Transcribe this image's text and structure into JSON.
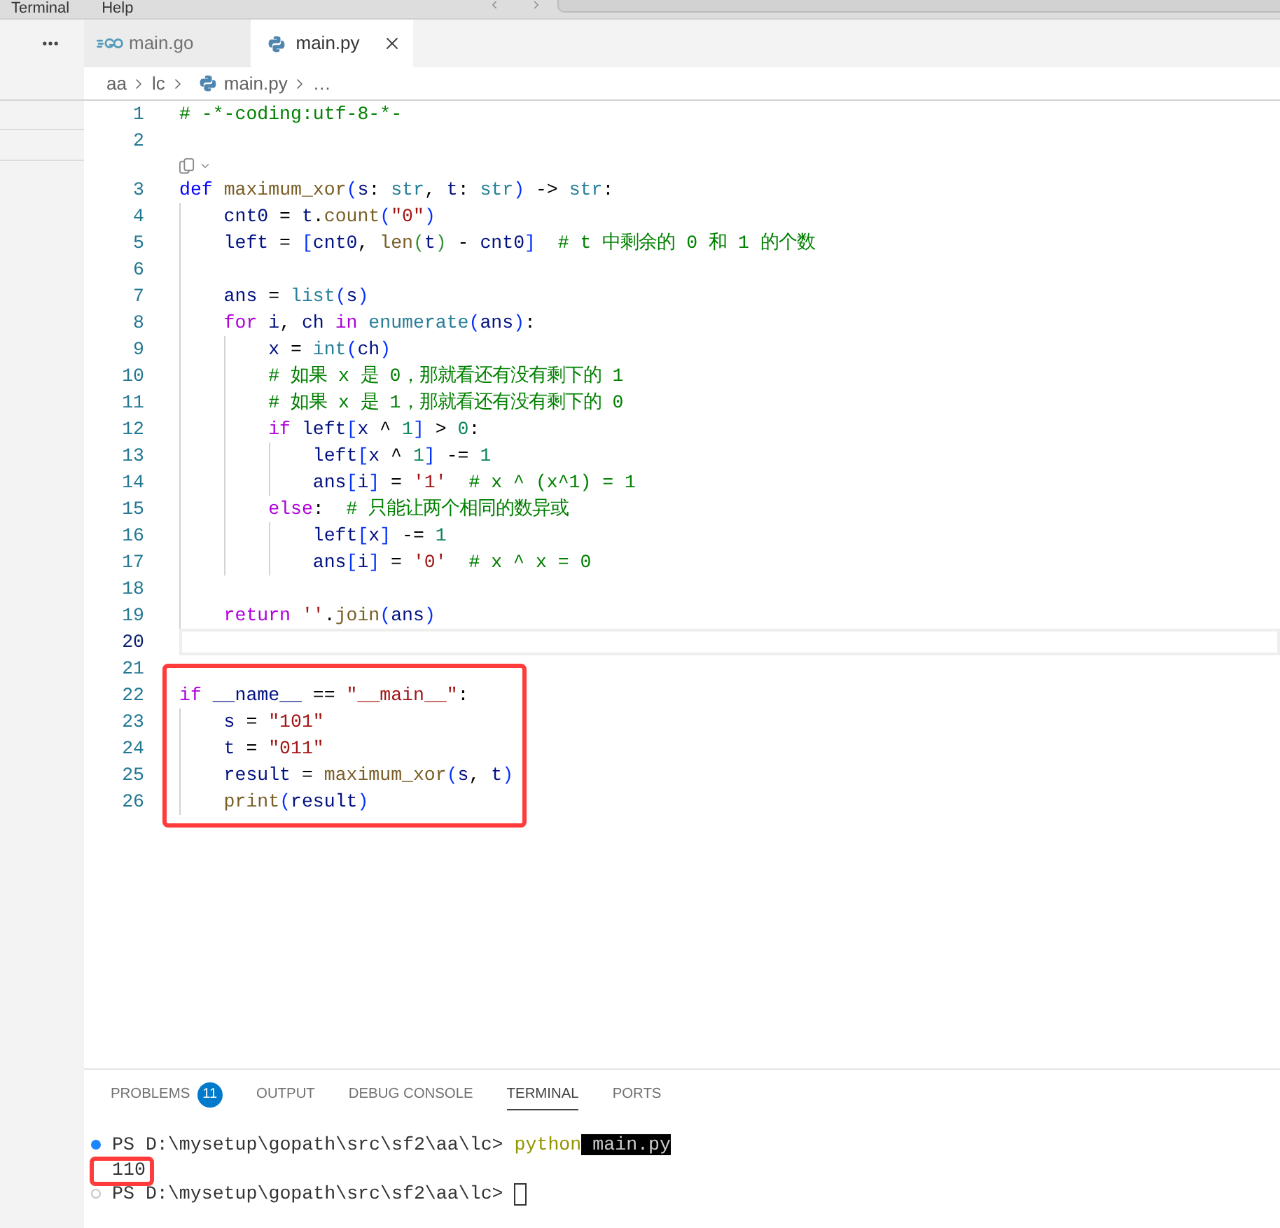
{
  "title_bar": {
    "menus": [
      "Terminal",
      "Help"
    ]
  },
  "tabs": [
    {
      "label": "main.go",
      "kind": "go",
      "selected": false
    },
    {
      "label": "main.py",
      "kind": "python",
      "selected": true
    }
  ],
  "breadcrumbs": [
    {
      "label": "aa",
      "kind": "folder"
    },
    {
      "label": "lc",
      "kind": "folder"
    },
    {
      "label": "main.py",
      "kind": "python"
    },
    {
      "label": "…",
      "kind": "symbol"
    }
  ],
  "editor": {
    "lines": [
      {
        "kind": "code",
        "number": "1",
        "current": false,
        "boxed": false,
        "tokens": [
          {
            "text": "# -*-coding:utf-8-*-",
            "kind": "comment"
          }
        ]
      },
      {
        "kind": "code",
        "number": "2",
        "current": false,
        "boxed": false
      },
      {
        "kind": "lens",
        "current": false,
        "boxed": false
      },
      {
        "kind": "code",
        "number": "3",
        "current": false,
        "boxed": false,
        "tokens": [
          {
            "text": "def ",
            "kind": "keyword"
          },
          {
            "text": "maximum_xor",
            "kind": "function"
          },
          {
            "text": "(",
            "kind": "bracket1"
          },
          {
            "text": "s",
            "kind": "variable"
          },
          {
            "text": ": ",
            "kind": "operator"
          },
          {
            "text": "str",
            "kind": "type"
          },
          {
            "text": ", ",
            "kind": "operator"
          },
          {
            "text": "t",
            "kind": "variable"
          },
          {
            "text": ": ",
            "kind": "operator"
          },
          {
            "text": "str",
            "kind": "type"
          },
          {
            "text": ")",
            "kind": "bracket1"
          },
          {
            "text": " -> ",
            "kind": "operator"
          },
          {
            "text": "str",
            "kind": "type"
          },
          {
            "text": ":",
            "kind": "operator"
          }
        ]
      },
      {
        "kind": "code",
        "number": "4",
        "current": false,
        "boxed": false,
        "tokens": [
          {
            "text": "    cnt0",
            "kind": "variable"
          },
          {
            "text": " = ",
            "kind": "operator"
          },
          {
            "text": "t",
            "kind": "variable"
          },
          {
            "text": ".",
            "kind": "operator"
          },
          {
            "text": "count",
            "kind": "function"
          },
          {
            "text": "(",
            "kind": "bracket1"
          },
          {
            "text": "\"0\"",
            "kind": "string"
          },
          {
            "text": ")",
            "kind": "bracket1"
          }
        ]
      },
      {
        "kind": "code",
        "number": "5",
        "current": false,
        "boxed": false,
        "tokens": [
          {
            "text": "    left",
            "kind": "variable"
          },
          {
            "text": " = ",
            "kind": "operator"
          },
          {
            "text": "[",
            "kind": "bracket1"
          },
          {
            "text": "cnt0",
            "kind": "variable"
          },
          {
            "text": ", ",
            "kind": "operator"
          },
          {
            "text": "len",
            "kind": "function"
          },
          {
            "text": "(",
            "kind": "bracket2"
          },
          {
            "text": "t",
            "kind": "variable"
          },
          {
            "text": ")",
            "kind": "bracket2"
          },
          {
            "text": " - ",
            "kind": "operator"
          },
          {
            "text": "cnt0",
            "kind": "variable"
          },
          {
            "text": "]",
            "kind": "bracket1"
          },
          {
            "text": "  # t 中剩余的 0 和 1 的个数",
            "kind": "comment"
          }
        ]
      },
      {
        "kind": "code",
        "number": "6",
        "current": false,
        "boxed": false
      },
      {
        "kind": "code",
        "number": "7",
        "current": false,
        "boxed": false,
        "tokens": [
          {
            "text": "    ans",
            "kind": "variable"
          },
          {
            "text": " = ",
            "kind": "operator"
          },
          {
            "text": "list",
            "kind": "type"
          },
          {
            "text": "(",
            "kind": "bracket1"
          },
          {
            "text": "s",
            "kind": "variable"
          },
          {
            "text": ")",
            "kind": "bracket1"
          }
        ]
      },
      {
        "kind": "code",
        "number": "8",
        "current": false,
        "boxed": false,
        "tokens": [
          {
            "text": "    for",
            "kind": "control"
          },
          {
            "text": " i",
            "kind": "variable"
          },
          {
            "text": ", ",
            "kind": "operator"
          },
          {
            "text": "ch",
            "kind": "variable"
          },
          {
            "text": " in",
            "kind": "control"
          },
          {
            "text": " enumerate",
            "kind": "type"
          },
          {
            "text": "(",
            "kind": "bracket1"
          },
          {
            "text": "ans",
            "kind": "variable"
          },
          {
            "text": ")",
            "kind": "bracket1"
          },
          {
            "text": ":",
            "kind": "operator"
          }
        ]
      },
      {
        "kind": "code",
        "number": "9",
        "current": false,
        "boxed": false,
        "tokens": [
          {
            "text": "        x",
            "kind": "variable"
          },
          {
            "text": " = ",
            "kind": "operator"
          },
          {
            "text": "int",
            "kind": "type"
          },
          {
            "text": "(",
            "kind": "bracket1"
          },
          {
            "text": "ch",
            "kind": "variable"
          },
          {
            "text": ")",
            "kind": "bracket1"
          }
        ]
      },
      {
        "kind": "code",
        "number": "10",
        "current": false,
        "boxed": false,
        "tokens": [
          {
            "text": "        # 如果 x 是 0，那就看还有没有剩下的 1",
            "kind": "comment"
          }
        ]
      },
      {
        "kind": "code",
        "number": "11",
        "current": false,
        "boxed": false,
        "tokens": [
          {
            "text": "        # 如果 x 是 1，那就看还有没有剩下的 0",
            "kind": "comment"
          }
        ]
      },
      {
        "kind": "code",
        "number": "12",
        "current": false,
        "boxed": false,
        "tokens": [
          {
            "text": "        if",
            "kind": "control"
          },
          {
            "text": " left",
            "kind": "variable"
          },
          {
            "text": "[",
            "kind": "bracket1"
          },
          {
            "text": "x",
            "kind": "variable"
          },
          {
            "text": " ^ ",
            "kind": "operator"
          },
          {
            "text": "1",
            "kind": "number"
          },
          {
            "text": "]",
            "kind": "bracket1"
          },
          {
            "text": " > ",
            "kind": "operator"
          },
          {
            "text": "0",
            "kind": "number"
          },
          {
            "text": ":",
            "kind": "operator"
          }
        ]
      },
      {
        "kind": "code",
        "number": "13",
        "current": false,
        "boxed": false,
        "tokens": [
          {
            "text": "            left",
            "kind": "variable"
          },
          {
            "text": "[",
            "kind": "bracket1"
          },
          {
            "text": "x",
            "kind": "variable"
          },
          {
            "text": " ^ ",
            "kind": "operator"
          },
          {
            "text": "1",
            "kind": "number"
          },
          {
            "text": "]",
            "kind": "bracket1"
          },
          {
            "text": " -= ",
            "kind": "operator"
          },
          {
            "text": "1",
            "kind": "number"
          }
        ]
      },
      {
        "kind": "code",
        "number": "14",
        "current": false,
        "boxed": false,
        "tokens": [
          {
            "text": "            ans",
            "kind": "variable"
          },
          {
            "text": "[",
            "kind": "bracket1"
          },
          {
            "text": "i",
            "kind": "variable"
          },
          {
            "text": "]",
            "kind": "bracket1"
          },
          {
            "text": " = ",
            "kind": "operator"
          },
          {
            "text": "'1'",
            "kind": "string"
          },
          {
            "text": "  # x ^ (x^1) = 1",
            "kind": "comment"
          }
        ]
      },
      {
        "kind": "code",
        "number": "15",
        "current": false,
        "boxed": false,
        "tokens": [
          {
            "text": "        else",
            "kind": "control"
          },
          {
            "text": ":",
            "kind": "operator"
          },
          {
            "text": "  # 只能让两个相同的数异或",
            "kind": "comment"
          }
        ]
      },
      {
        "kind": "code",
        "number": "16",
        "current": false,
        "boxed": false,
        "tokens": [
          {
            "text": "            left",
            "kind": "variable"
          },
          {
            "text": "[",
            "kind": "bracket1"
          },
          {
            "text": "x",
            "kind": "variable"
          },
          {
            "text": "]",
            "kind": "bracket1"
          },
          {
            "text": " -= ",
            "kind": "operator"
          },
          {
            "text": "1",
            "kind": "number"
          }
        ]
      },
      {
        "kind": "code",
        "number": "17",
        "current": false,
        "boxed": false,
        "tokens": [
          {
            "text": "            ans",
            "kind": "variable"
          },
          {
            "text": "[",
            "kind": "bracket1"
          },
          {
            "text": "i",
            "kind": "variable"
          },
          {
            "text": "]",
            "kind": "bracket1"
          },
          {
            "text": " = ",
            "kind": "operator"
          },
          {
            "text": "'0'",
            "kind": "string"
          },
          {
            "text": "  # x ^ x = 0",
            "kind": "comment"
          }
        ]
      },
      {
        "kind": "code",
        "number": "18",
        "current": false,
        "boxed": false
      },
      {
        "kind": "code",
        "number": "19",
        "current": false,
        "boxed": false,
        "tokens": [
          {
            "text": "    return",
            "kind": "control"
          },
          {
            "text": " ''",
            "kind": "string"
          },
          {
            "text": ".",
            "kind": "operator"
          },
          {
            "text": "join",
            "kind": "function"
          },
          {
            "text": "(",
            "kind": "bracket1"
          },
          {
            "text": "ans",
            "kind": "variable"
          },
          {
            "text": ")",
            "kind": "bracket1"
          }
        ]
      },
      {
        "kind": "code",
        "number": "20",
        "current": true,
        "boxed": false
      },
      {
        "kind": "code",
        "number": "21",
        "current": false,
        "boxed": false
      },
      {
        "kind": "code",
        "number": "22",
        "current": false,
        "boxed": true,
        "tokens": [
          {
            "text": "if",
            "kind": "control"
          },
          {
            "text": " __name__",
            "kind": "variable"
          },
          {
            "text": " == ",
            "kind": "operator"
          },
          {
            "text": "\"__main__\"",
            "kind": "string"
          },
          {
            "text": ":",
            "kind": "operator"
          }
        ]
      },
      {
        "kind": "code",
        "number": "23",
        "current": false,
        "boxed": true,
        "tokens": [
          {
            "text": "    s",
            "kind": "variable"
          },
          {
            "text": " = ",
            "kind": "operator"
          },
          {
            "text": "\"101\"",
            "kind": "string"
          }
        ]
      },
      {
        "kind": "code",
        "number": "24",
        "current": false,
        "boxed": true,
        "tokens": [
          {
            "text": "    t",
            "kind": "variable"
          },
          {
            "text": " = ",
            "kind": "operator"
          },
          {
            "text": "\"011\"",
            "kind": "string"
          }
        ]
      },
      {
        "kind": "code",
        "number": "25",
        "current": false,
        "boxed": true,
        "tokens": [
          {
            "text": "    result",
            "kind": "variable"
          },
          {
            "text": " = ",
            "kind": "operator"
          },
          {
            "text": "maximum_xor",
            "kind": "function"
          },
          {
            "text": "(",
            "kind": "bracket1"
          },
          {
            "text": "s",
            "kind": "variable"
          },
          {
            "text": ", ",
            "kind": "operator"
          },
          {
            "text": "t",
            "kind": "variable"
          },
          {
            "text": ")",
            "kind": "bracket1"
          }
        ]
      },
      {
        "kind": "code",
        "number": "26",
        "current": false,
        "boxed": true,
        "tokens": [
          {
            "text": "    print",
            "kind": "function"
          },
          {
            "text": "(",
            "kind": "bracket1"
          },
          {
            "text": "result",
            "kind": "variable"
          },
          {
            "text": ")",
            "kind": "bracket1"
          }
        ]
      }
    ]
  },
  "panel": {
    "tabs": [
      {
        "label": "PROBLEMS",
        "badge": "11",
        "selected": false
      },
      {
        "label": "OUTPUT",
        "selected": false
      },
      {
        "label": "DEBUG CONSOLE",
        "selected": false
      },
      {
        "label": "TERMINAL",
        "selected": true
      },
      {
        "label": "PORTS",
        "selected": false
      }
    ]
  },
  "terminal": {
    "lines": [
      {
        "kind": "command",
        "ran": true,
        "boxed": false,
        "cursor": false,
        "segments": [
          {
            "text": "PS D:\\mysetup\\gopath\\src\\sf2\\aa\\lc> ",
            "kind": "prompt"
          },
          {
            "text": "python",
            "kind": "command"
          },
          {
            "text": " main.py",
            "kind": "argument"
          }
        ]
      },
      {
        "kind": "output",
        "boxed": true,
        "cursor": false,
        "text": "110"
      },
      {
        "kind": "command",
        "ran": false,
        "boxed": false,
        "cursor": true,
        "segments": [
          {
            "text": "PS D:\\mysetup\\gopath\\src\\sf2\\aa\\lc> ",
            "kind": "prompt"
          }
        ]
      }
    ]
  }
}
